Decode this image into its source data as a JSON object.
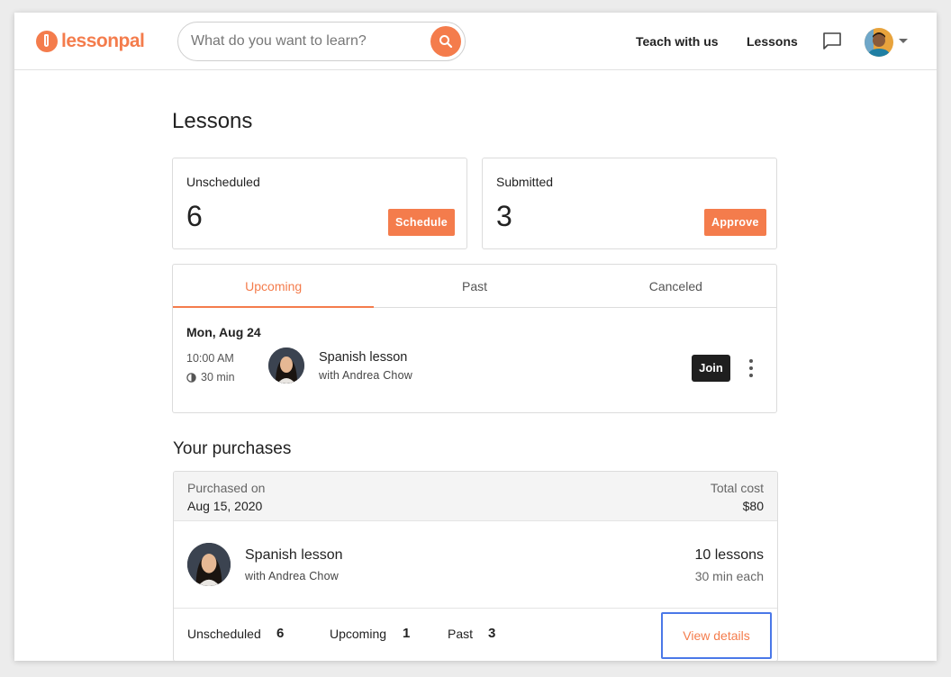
{
  "header": {
    "logo_text": "lessonpal",
    "search_placeholder": "What do you want to learn?",
    "nav": {
      "teach": "Teach with us",
      "lessons": "Lessons"
    }
  },
  "page_title": "Lessons",
  "stats": {
    "unscheduled": {
      "label": "Unscheduled",
      "value": "6",
      "button": "Schedule"
    },
    "submitted": {
      "label": "Submitted",
      "value": "3",
      "button": "Approve"
    }
  },
  "tabs": [
    {
      "label": "Upcoming",
      "active": true
    },
    {
      "label": "Past",
      "active": false
    },
    {
      "label": "Canceled",
      "active": false
    }
  ],
  "upcoming_lesson": {
    "date": "Mon, Aug 24",
    "time": "10:00 AM",
    "duration": "30 min",
    "name": "Spanish lesson",
    "with": "with Andrea Chow",
    "join_label": "Join"
  },
  "purchases": {
    "title": "Your purchases",
    "purchased_on_label": "Purchased on",
    "purchased_on": "Aug 15, 2020",
    "total_cost_label": "Total cost",
    "total_cost": "$80",
    "lesson_name": "Spanish lesson",
    "lesson_with": "with Andrea Chow",
    "lesson_count": "10 lessons",
    "lesson_each": "30 min each",
    "footer": {
      "unscheduled_label": "Unscheduled",
      "unscheduled": "6",
      "upcoming_label": "Upcoming",
      "upcoming": "1",
      "past_label": "Past",
      "past": "3",
      "view_details": "View details"
    }
  },
  "colors": {
    "accent": "#f47c4c",
    "highlight": "#4a78e8",
    "dark_button": "#1f1f1f"
  }
}
